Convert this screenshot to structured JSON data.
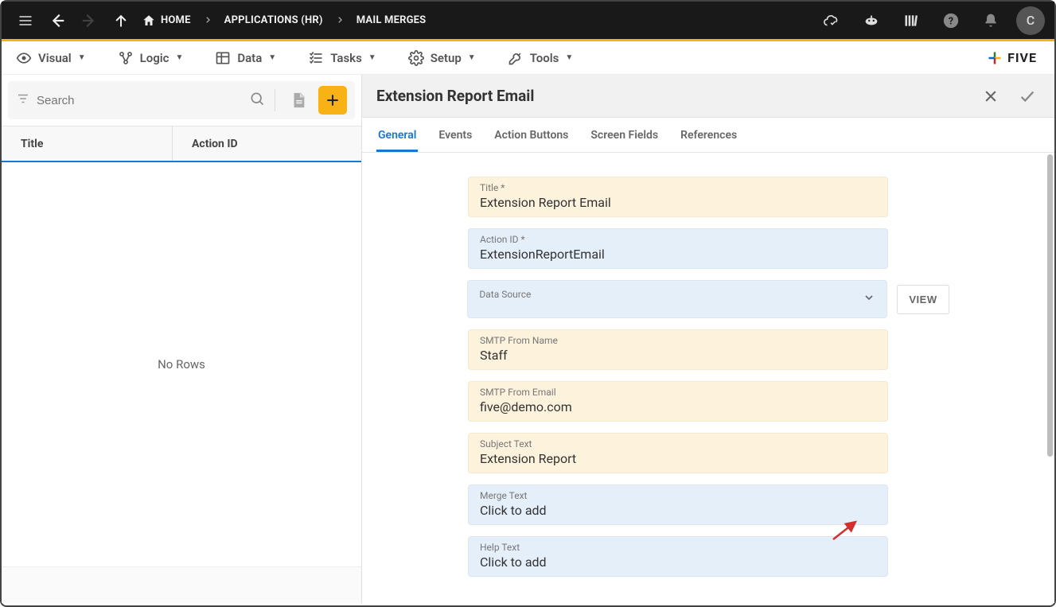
{
  "topbar": {
    "home_label": "HOME",
    "breadcrumbs": [
      "APPLICATIONS (HR)",
      "MAIL MERGES"
    ],
    "avatar_letter": "C"
  },
  "menubar": {
    "items": [
      {
        "label": "Visual"
      },
      {
        "label": "Logic"
      },
      {
        "label": "Data"
      },
      {
        "label": "Tasks"
      },
      {
        "label": "Setup"
      },
      {
        "label": "Tools"
      }
    ],
    "brand": "FIVE"
  },
  "left": {
    "search_placeholder": "Search",
    "columns": [
      "Title",
      "Action ID"
    ],
    "empty_text": "No Rows"
  },
  "detail": {
    "title": "Extension Report Email",
    "tabs": [
      "General",
      "Events",
      "Action Buttons",
      "Screen Fields",
      "References"
    ],
    "active_tab": 0,
    "fields": {
      "title": {
        "label": "Title *",
        "value": "Extension Report Email"
      },
      "action_id": {
        "label": "Action ID *",
        "value": "ExtensionReportEmail"
      },
      "data_source": {
        "label": "Data Source",
        "value": ""
      },
      "smtp_from_name": {
        "label": "SMTP From Name",
        "value": "Staff"
      },
      "smtp_from_email": {
        "label": "SMTP From Email",
        "value": "five@demo.com"
      },
      "subject_text": {
        "label": "Subject Text",
        "value": "Extension Report"
      },
      "merge_text": {
        "label": "Merge Text",
        "value": "Click to add"
      },
      "help_text": {
        "label": "Help Text",
        "value": "Click to add"
      }
    },
    "view_button": "VIEW"
  }
}
